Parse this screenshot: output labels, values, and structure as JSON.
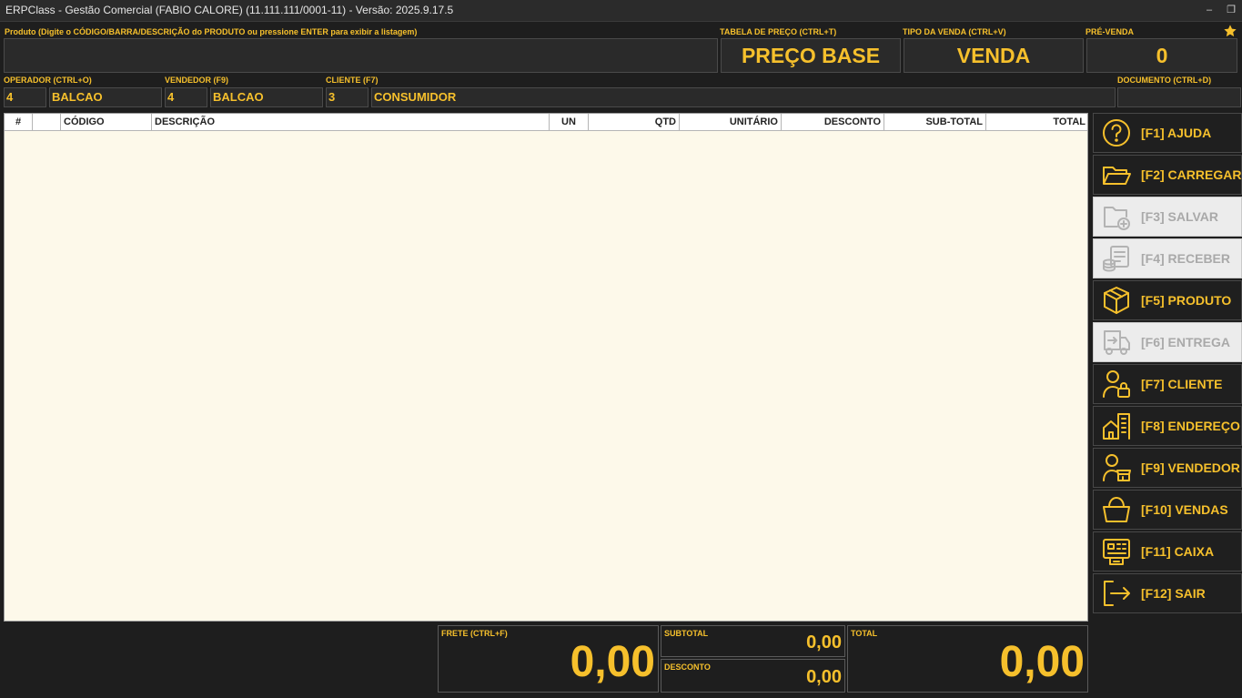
{
  "window": {
    "title": "ERPClass - Gestão Comercial (FABIO CALORE) (11.111.111/0001-11) - Versão: 2025.9.17.5",
    "minimize": "–",
    "restore": "❐"
  },
  "product": {
    "label": "Produto (Digite o CÓDIGO/BARRA/DESCRIÇÃO do PRODUTO ou pressione ENTER para exibir a listagem)",
    "value": ""
  },
  "price_table": {
    "label": "TABELA DE PREÇO (CTRL+T)",
    "value": "PREÇO BASE"
  },
  "sale_type": {
    "label": "TIPO DA VENDA (CTRL+V)",
    "value": "VENDA"
  },
  "pre_sale": {
    "label": "PRÉ-VENDA",
    "value": "0"
  },
  "favorite_icon": "star-icon",
  "operator": {
    "label": "OPERADOR (CTRL+O)",
    "code": "4",
    "name": "BALCAO"
  },
  "seller": {
    "label": "VENDEDOR (F9)",
    "code": "4",
    "name": "BALCAO"
  },
  "client": {
    "label": "CLIENTE (F7)",
    "code": "3",
    "name": "CONSUMIDOR"
  },
  "document": {
    "label": "DOCUMENTO (CTRL+D)",
    "value": ""
  },
  "grid": {
    "columns": [
      "#",
      "",
      "CÓDIGO",
      "DESCRIÇÃO",
      "UN",
      "QTD",
      "UNITÁRIO",
      "DESCONTO",
      "SUB-TOTAL",
      "TOTAL"
    ],
    "rows": []
  },
  "actions": [
    {
      "label": "[F1] AJUDA",
      "icon": "help-icon",
      "enabled": true
    },
    {
      "label": "[F2] CARREGAR",
      "icon": "folder-open-icon",
      "enabled": true
    },
    {
      "label": "[F3] SALVAR",
      "icon": "folder-add-icon",
      "enabled": false
    },
    {
      "label": "[F4] RECEBER",
      "icon": "money-receive-icon",
      "enabled": false
    },
    {
      "label": "[F5] PRODUTO",
      "icon": "box-icon",
      "enabled": true
    },
    {
      "label": "[F6] ENTREGA",
      "icon": "delivery-truck-icon",
      "enabled": false
    },
    {
      "label": "[F7] CLIENTE",
      "icon": "user-lock-icon",
      "enabled": true
    },
    {
      "label": "[F8] ENDEREÇO",
      "icon": "buildings-icon",
      "enabled": true
    },
    {
      "label": "[F9] VENDEDOR",
      "icon": "user-store-icon",
      "enabled": true
    },
    {
      "label": "[F10] VENDAS",
      "icon": "basket-icon",
      "enabled": true
    },
    {
      "label": "[F11] CAIXA",
      "icon": "cash-register-icon",
      "enabled": true
    },
    {
      "label": "[F12] SAIR",
      "icon": "logout-icon",
      "enabled": true
    }
  ],
  "totals": {
    "freight": {
      "label": "FRETE (CTRL+F)",
      "value": "0,00"
    },
    "subtotal": {
      "label": "SUBTOTAL",
      "value": "0,00"
    },
    "discount": {
      "label": "DESCONTO",
      "value": "0,00"
    },
    "total": {
      "label": "TOTAL",
      "value": "0,00"
    }
  },
  "colors": {
    "accent": "#f6c02c",
    "background": "#1e1e1e",
    "grid_background": "#fdf9ea",
    "disabled_button": "#ececec"
  }
}
